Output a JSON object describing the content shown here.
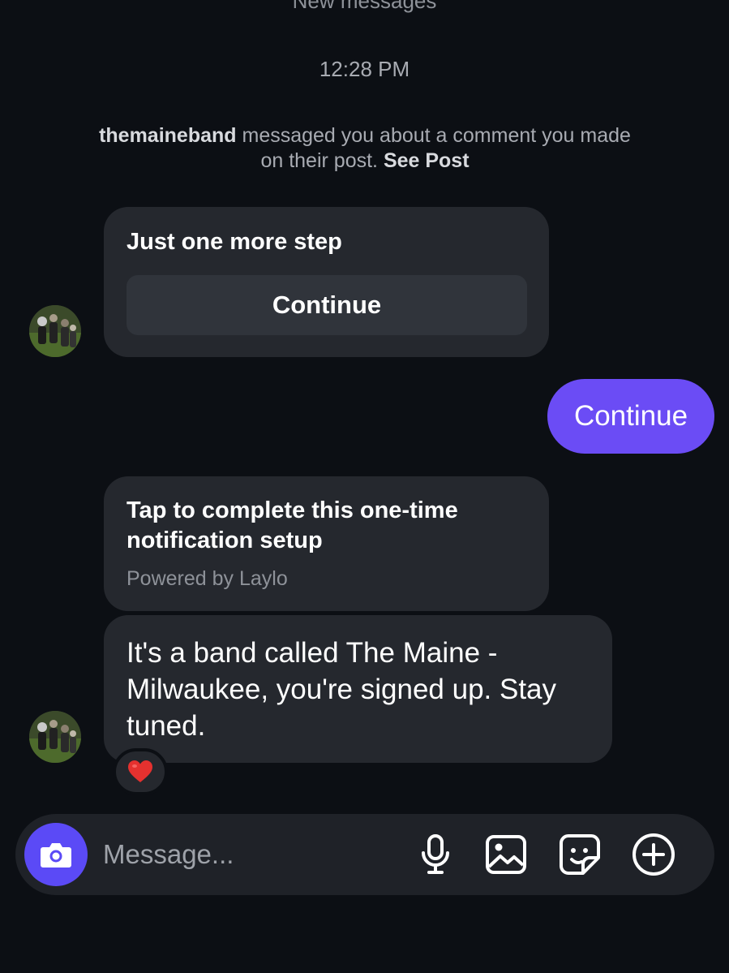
{
  "thread": {
    "divider_label": "New messages",
    "timestamp": "12:28 PM",
    "context": {
      "sender": "themaineband",
      "text": " messaged you about a comment you made on their post. ",
      "link": "See Post"
    }
  },
  "messages": {
    "card1": {
      "title": "Just one more step",
      "button": "Continue"
    },
    "outgoing": {
      "text": "Continue"
    },
    "card2": {
      "title": "Tap to complete this one-time notification setup",
      "subtitle": "Powered by Laylo"
    },
    "reply": {
      "text": "It's a band called The Maine - Milwaukee, you're signed up. Stay tuned.",
      "reaction": "heart-emoji"
    }
  },
  "composer": {
    "placeholder": "Message...",
    "icons": [
      "camera-icon",
      "microphone-icon",
      "gallery-icon",
      "sticker-icon",
      "plus-circle-icon"
    ]
  },
  "colors": {
    "background": "#0c0f14",
    "bubble": "#25282e",
    "accent": "#6b4cf5",
    "camera": "#5b4af6",
    "reaction": "#e5312f"
  }
}
